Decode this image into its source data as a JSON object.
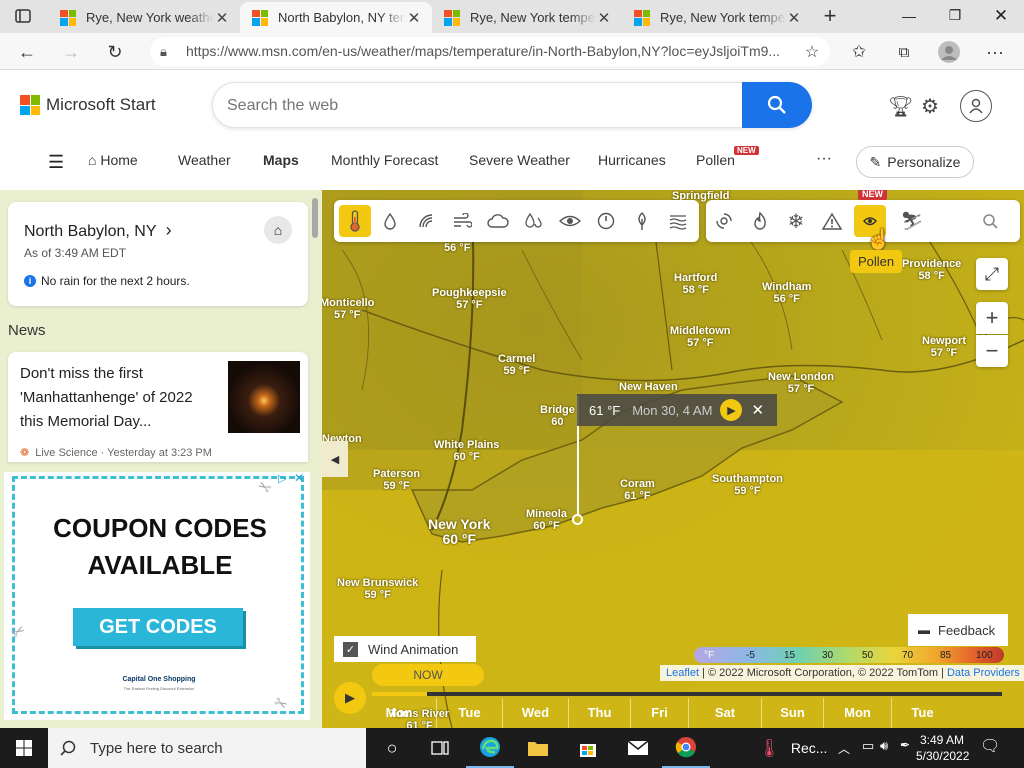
{
  "browser": {
    "tabs": [
      {
        "title": "Rye, New York weather",
        "active": false
      },
      {
        "title": "North Babylon, NY tem",
        "active": true
      },
      {
        "title": "Rye, New York tempera",
        "active": false
      },
      {
        "title": "Rye, New York tempera",
        "active": false
      }
    ],
    "new_tab_glyph": "+",
    "url": "https://www.msn.com/en-us/weather/maps/temperature/in-North-Babylon,NY?loc=eyJsljoiTm9..."
  },
  "msn": {
    "brand": "Microsoft Start",
    "search_placeholder": "Search the web",
    "nav": [
      {
        "label": "Home"
      },
      {
        "label": "Weather"
      },
      {
        "label": "Maps"
      },
      {
        "label": "Monthly Forecast"
      },
      {
        "label": "Severe Weather"
      },
      {
        "label": "Hurricanes"
      },
      {
        "label": "Pollen"
      }
    ],
    "new_badge": "NEW",
    "more": "···",
    "personalize": "Personalize"
  },
  "location_card": {
    "name": "North Babylon, NY",
    "asof": "As of 3:49 AM EDT",
    "rain_note": "No rain for the next 2 hours."
  },
  "news": {
    "heading": "News",
    "item": {
      "title": "Don't miss the first 'Manhattanhenge' of 2022 this Memorial Day...",
      "source": "Live Science · Yesterday at 3:23 PM"
    }
  },
  "ad": {
    "headline": "COUPON CODES AVAILABLE",
    "cta": "GET CODES",
    "brand": "Capital One Shopping",
    "brand_tagline": "The Easiest Finding Discount Extension"
  },
  "map": {
    "tooltip": {
      "temp": "61 °F",
      "time": "Mon 30, 4 AM"
    },
    "hover_tip": "Pollen",
    "tool_new_badge": "NEW",
    "labels": [
      {
        "name": "Springfield",
        "temp": ""
      },
      {
        "name": "",
        "temp": "56 °F"
      },
      {
        "name": "Poughkeepsie",
        "temp": "57 °F"
      },
      {
        "name": "Hartford",
        "temp": "58 °F"
      },
      {
        "name": "Windham",
        "temp": "56 °F"
      },
      {
        "name": "Providence",
        "temp": "58 °F"
      },
      {
        "name": "Monticello",
        "temp": "57 °F"
      },
      {
        "name": "Middletown",
        "temp": "57 °F"
      },
      {
        "name": "Carmel",
        "temp": "59 °F"
      },
      {
        "name": "Newport",
        "temp": "57 °F"
      },
      {
        "name": "New London",
        "temp": "57 °F"
      },
      {
        "name": "New Haven",
        "temp": ""
      },
      {
        "name": "Bridge",
        "temp": "60"
      },
      {
        "name": "Newton",
        "temp": "°F"
      },
      {
        "name": "White Plains",
        "temp": "60 °F"
      },
      {
        "name": "Paterson",
        "temp": "59 °F"
      },
      {
        "name": "Coram",
        "temp": "61 °F"
      },
      {
        "name": "Southampton",
        "temp": "59 °F"
      },
      {
        "name": "Mineola",
        "temp": "60 °F"
      },
      {
        "name": "New York",
        "temp": "60 °F"
      },
      {
        "name": "New Brunswick",
        "temp": "59 °F"
      },
      {
        "name": "Toms River",
        "temp": "61 °F"
      }
    ],
    "wind_animation": "Wind Animation",
    "feedback": "Feedback",
    "legend": [
      "°F",
      "-5",
      "15",
      "30",
      "50",
      "70",
      "85",
      "100"
    ],
    "attribution": {
      "leaflet": "Leaflet",
      "copyright": " | © 2022 Microsoft Corporation, © 2022 TomTom | ",
      "providers": "Data Providers"
    },
    "now_label": "NOW",
    "days": [
      "Mon",
      "Tue",
      "Wed",
      "Thu",
      "Fri",
      "Sat",
      "Sun",
      "Mon",
      "Tue"
    ]
  },
  "taskbar": {
    "search_placeholder": "Type here to search",
    "recording": "Rec...",
    "time": "3:49 AM",
    "date": "5/30/2022"
  }
}
